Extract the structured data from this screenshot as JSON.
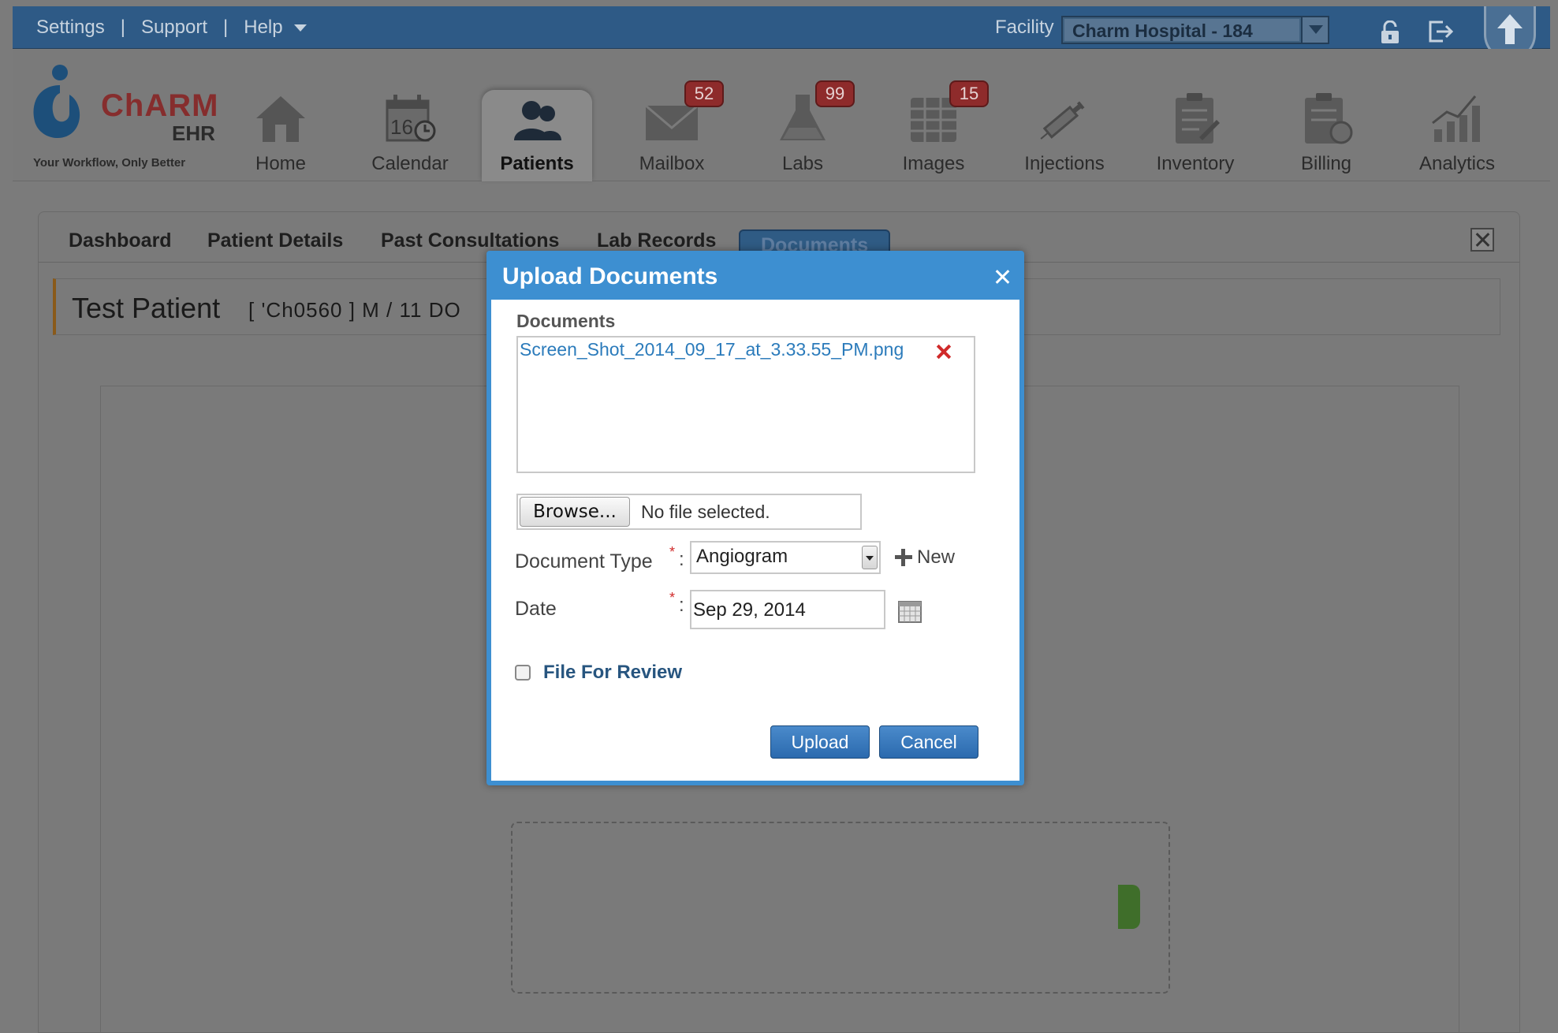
{
  "topbar": {
    "links": [
      "Settings",
      "Support",
      "Help"
    ],
    "facility_label": "Facility",
    "facility_value": "Charm Hospital - 184"
  },
  "logo": {
    "brand": "ChARM",
    "product": "EHR",
    "tagline": "Your Workflow, Only Better"
  },
  "nav": [
    {
      "label": "Home",
      "icon": "home-icon"
    },
    {
      "label": "Calendar",
      "icon": "calendar-icon",
      "icon_text": "16"
    },
    {
      "label": "Patients",
      "icon": "patients-icon",
      "active": true
    },
    {
      "label": "Mailbox",
      "icon": "mailbox-icon",
      "badge": "52"
    },
    {
      "label": "Labs",
      "icon": "labs-icon",
      "badge": "99"
    },
    {
      "label": "Images",
      "icon": "images-icon",
      "badge": "15"
    },
    {
      "label": "Injections",
      "icon": "syringe-icon"
    },
    {
      "label": "Inventory",
      "icon": "inventory-icon"
    },
    {
      "label": "Billing",
      "icon": "billing-icon"
    },
    {
      "label": "Analytics",
      "icon": "analytics-icon"
    }
  ],
  "tabs": [
    "Dashboard",
    "Patient Details",
    "Past Consultations",
    "Lab Records",
    "Documents"
  ],
  "active_tab": "Documents",
  "patient": {
    "name": "Test Patient",
    "meta": "[ 'Ch0560 ]  M / 11   DO"
  },
  "modal": {
    "title": "Upload Documents",
    "documents_label": "Documents",
    "file_name": "Screen_Shot_2014_09_17_at_3.33.55_PM.png",
    "browse_label": "Browse...",
    "browse_status": "No file selected.",
    "document_type_label": "Document Type",
    "document_type_value": "Angiogram",
    "new_label": "New",
    "date_label": "Date",
    "date_value": "Sep 29, 2014",
    "required_mark": "*",
    "colon": ":",
    "review_label": "File For Review",
    "upload_label": "Upload",
    "cancel_label": "Cancel"
  },
  "colors": {
    "topbar": "#2e5a86",
    "modal_accent": "#3d8fd1",
    "badge": "#8e2b2b",
    "button": "#2b6aae",
    "link": "#2b7bbb"
  }
}
